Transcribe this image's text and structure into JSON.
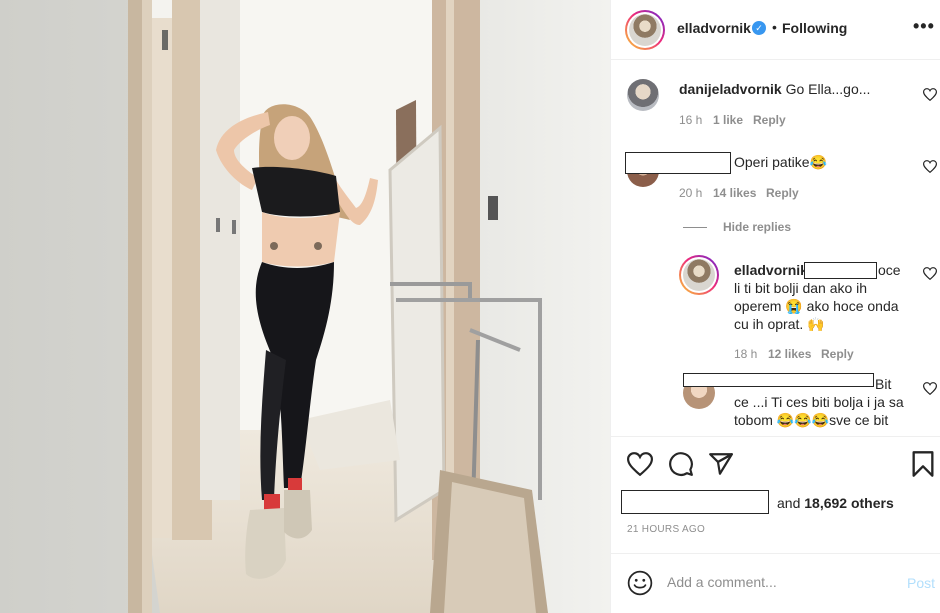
{
  "post": {
    "author": "elladvornik",
    "separator": "•",
    "follow_state": "Following",
    "more_label": "•••"
  },
  "comments": [
    {
      "user": "danijeladvornik",
      "text": "Go Ella...go...",
      "time": "16 h",
      "likes": "1 like",
      "reply": "Reply"
    },
    {
      "user": "",
      "text": "Operi patike😂",
      "time": "20 h",
      "likes": "14 likes",
      "reply": "Reply",
      "hide_replies": "Hide replies"
    }
  ],
  "replies": [
    {
      "user": "elladvornik",
      "line1_suffix": "oce",
      "line2": "li ti bit bolji dan ako ih",
      "line3": "operem 😭 ako hoce onda",
      "line4": "cu ih oprat. 🙌",
      "time": "18 h",
      "likes": "12 likes",
      "reply": "Reply"
    },
    {
      "line1_suffix": "Bit",
      "line2": "ce ...i Ti ces biti bolja i ja sa",
      "line3": "tobom 😂😂😂sve ce bit"
    }
  ],
  "likes_summary": {
    "conjunction": "and",
    "count": "18,692 others"
  },
  "timestamp": "21 HOURS AGO",
  "add_comment": {
    "placeholder": "Add a comment...",
    "post_label": "Post"
  },
  "icons": [
    "heart-icon",
    "comment-icon",
    "share-icon",
    "bookmark-icon",
    "emoji-icon",
    "verified-icon",
    "more-icon"
  ],
  "colors": {
    "verified": "#3897f0",
    "post_disabled": "#b2dffc",
    "muted": "#8e8e8e",
    "text": "#262626"
  }
}
